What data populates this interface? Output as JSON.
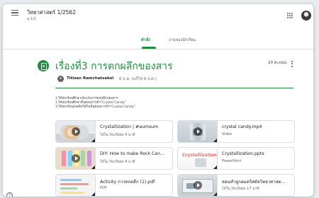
{
  "header": {
    "class_title": "วิทยาศาสตร์ 1/2562",
    "class_section": "ม.1/1",
    "menu_icon": "hamburger-menu-icon",
    "apps_icon": "google-apps-grid-icon",
    "avatar": "account-avatar"
  },
  "tabs": [
    {
      "label": "คำสั่ง",
      "active": true
    },
    {
      "label": "งานของนักเรียน",
      "active": false
    }
  ],
  "assignment": {
    "title": "เรื่องที่3 การตกผลึกของสาร",
    "points": "20 คะแนน",
    "author": "Titisan Ramchatsakol",
    "date": "6 ธ.ค. (แก้ไข 6 ธ.ค.)",
    "instructions": [
      "1.ให้นักเรียนศึกษาเกี่ยวกับการตกผลึกของสาร",
      "2.ให้นักเรียนศึกษาขั้นตอนการทำ\"Crystal Candy\"",
      "3.ให้นักเรียนส่งคลิปวิดีโอขั้นตอนการทำ\"Crystal Candy\""
    ]
  },
  "attachments": [
    {
      "title": "Crystallization | #aumsum",
      "subtitle": "ได้ใน YouTube  4 นาที",
      "thumb": "video-thumbnail-crystallization"
    },
    {
      "title": "crystal candy.mp4",
      "subtitle": "Video",
      "thumb": "video-thumbnail-crystal-jar"
    },
    {
      "title": "DIY: How to make Rock Can...",
      "subtitle": "ได้ใน YouTube  4 นาที",
      "thumb": "video-thumbnail-rock-candy"
    },
    {
      "title": "Crystallization.pptx",
      "subtitle": "PowerPoint",
      "thumb": "powerpoint-thumbnail"
    },
    {
      "title": "Activity การตกผลึก (1).pdf",
      "subtitle": "PDF",
      "thumb": "pdf-thumbnail"
    },
    {
      "title": "สอนทำลูกอมคริสตัลวิทยาศาสต...",
      "subtitle": "ได้ใน YouTube  17 นาที",
      "thumb": "video-thumbnail-lesson"
    }
  ],
  "thumb_text": {
    "ppt": "Crystallization"
  },
  "colors": {
    "accent": "#1e8e3e",
    "text": "#202124",
    "muted": "#5f6368",
    "border": "#dadce0"
  }
}
